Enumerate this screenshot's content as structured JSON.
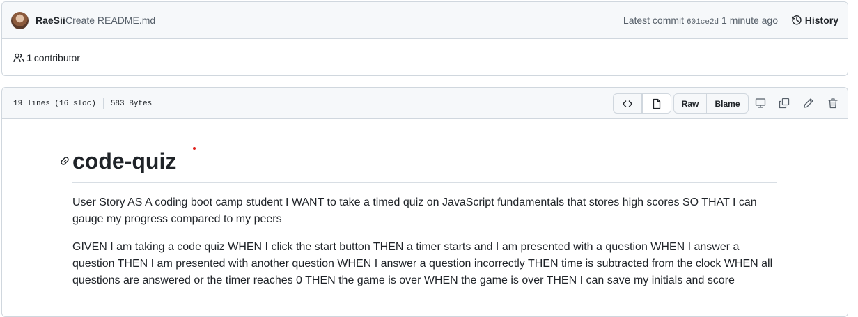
{
  "commit": {
    "author": "RaeSii",
    "message": "Create README.md",
    "latest_label": "Latest commit",
    "sha": "601ce2d",
    "time_ago": "1 minute ago",
    "history_label": "History"
  },
  "contributors": {
    "count": "1",
    "label": "contributor"
  },
  "file": {
    "lines": "19 lines (16 sloc)",
    "size": "583 Bytes",
    "raw_label": "Raw",
    "blame_label": "Blame"
  },
  "readme": {
    "title": "code-quiz",
    "paragraph_1": "User Story AS A coding boot camp student I WANT to take a timed quiz on JavaScript fundamentals that stores high scores SO THAT I can gauge my progress compared to my peers",
    "paragraph_2": "GIVEN I am taking a code quiz WHEN I click the start button THEN a timer starts and I am presented with a question WHEN I answer a question THEN I am presented with another question WHEN I answer a question incorrectly THEN time is subtracted from the clock WHEN all questions are answered or the timer reaches 0 THEN the game is over WHEN the game is over THEN I can save my initials and score"
  },
  "icons": {
    "history": "history-icon",
    "contributors": "people-icon",
    "code_view": "code-icon",
    "preview": "file-icon",
    "display": "desktop-icon",
    "copy": "copy-icon",
    "edit": "pencil-icon",
    "delete": "trash-icon",
    "anchor": "link-icon"
  },
  "colors": {
    "border": "#d0d7de",
    "header_bg": "#f6f8fa",
    "text": "#1f2328",
    "muted": "#57606a"
  }
}
